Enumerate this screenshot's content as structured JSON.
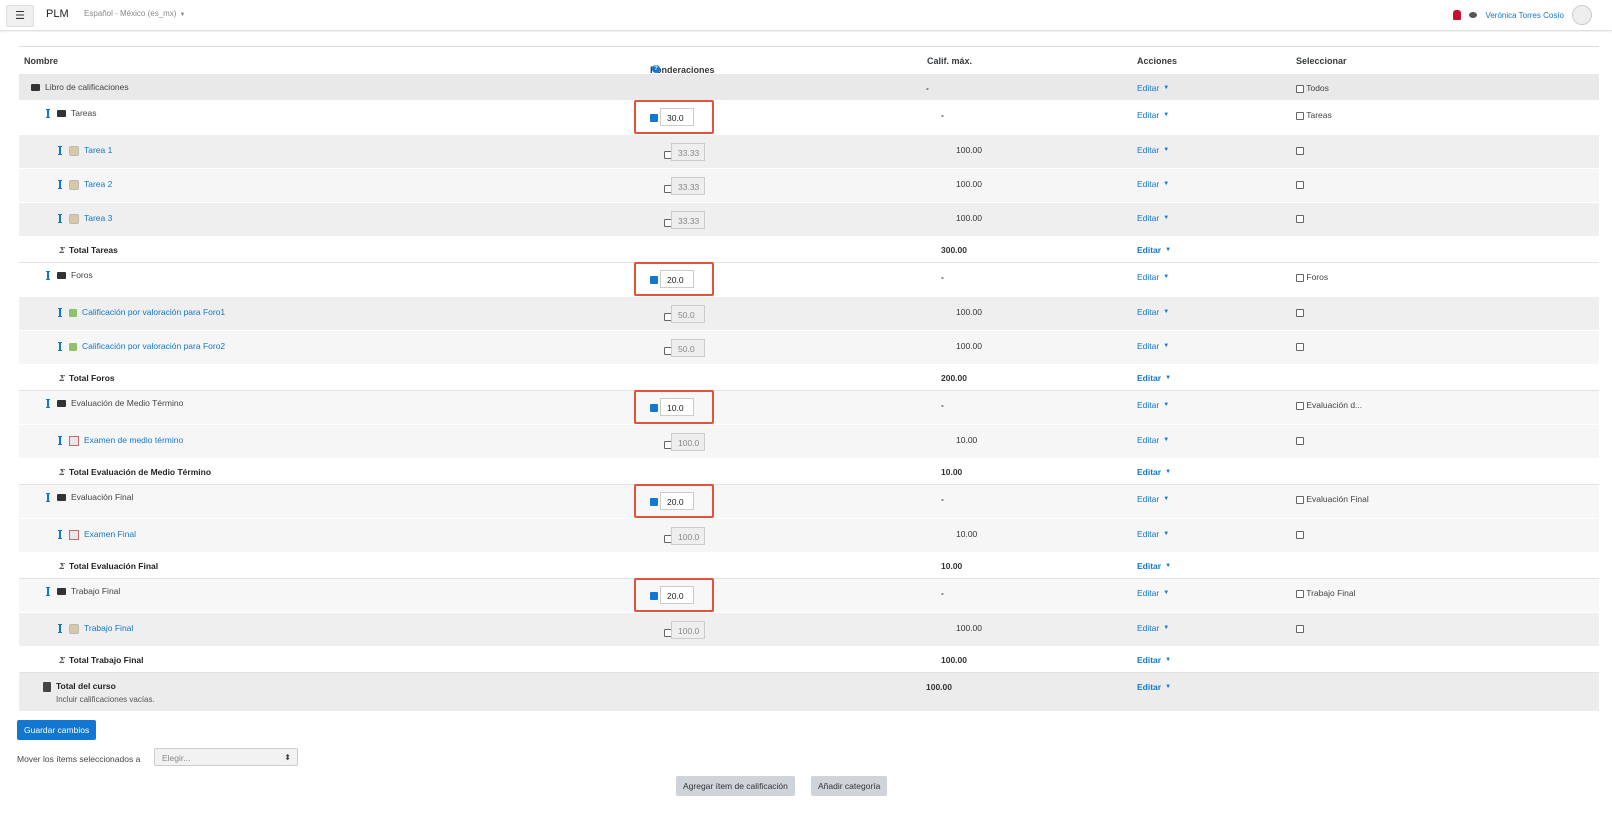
{
  "nav": {
    "menu_icon": "hamburger-icon",
    "brand": "PLM",
    "language": "Español - México (es_mx)",
    "user_name": "Verónica Torres Cosío"
  },
  "table": {
    "headers": {
      "name": "Nombre",
      "weights": "Ponderaciones",
      "max": "Calif. máx.",
      "actions": "Acciones",
      "select": "Seleccionar"
    },
    "rows": [
      {
        "name": "Libro de calificaciones",
        "max": "-",
        "action": "Editar",
        "select": "Todos"
      },
      {
        "name": "Tareas",
        "weight": "30.0",
        "max": "-",
        "action": "Editar",
        "select": "Tareas"
      },
      {
        "name": "Tarea 1",
        "weight": "33.33",
        "max": "100.00",
        "action": "Editar",
        "select": ""
      },
      {
        "name": "Tarea 2",
        "weight": "33.33",
        "max": "100.00",
        "action": "Editar",
        "select": ""
      },
      {
        "name": "Tarea 3",
        "weight": "33.33",
        "max": "100.00",
        "action": "Editar",
        "select": ""
      },
      {
        "name": "Total Tareas",
        "max": "300.00",
        "action": "Editar"
      },
      {
        "name": "Foros",
        "weight": "20.0",
        "max": "-",
        "action": "Editar",
        "select": "Foros"
      },
      {
        "name": "Calificación por valoración para Foro1",
        "weight": "50.0",
        "max": "100.00",
        "action": "Editar",
        "select": ""
      },
      {
        "name": "Calificación por valoración para Foro2",
        "weight": "50.0",
        "max": "100.00",
        "action": "Editar",
        "select": ""
      },
      {
        "name": "Total Foros",
        "max": "200.00",
        "action": "Editar"
      },
      {
        "name": "Evaluación de Medio Término",
        "weight": "10.0",
        "max": "-",
        "action": "Editar",
        "select": "Evaluación d..."
      },
      {
        "name": "Examen de medio término",
        "weight": "100.0",
        "max": "10.00",
        "action": "Editar",
        "select": ""
      },
      {
        "name": "Total Evaluación de Medio Término",
        "max": "10.00",
        "action": "Editar"
      },
      {
        "name": "Evaluación Final",
        "weight": "20.0",
        "max": "-",
        "action": "Editar",
        "select": "Evaluación Final"
      },
      {
        "name": "Examen Final",
        "weight": "100.0",
        "max": "10.00",
        "action": "Editar",
        "select": ""
      },
      {
        "name": "Total Evaluación Final",
        "max": "10.00",
        "action": "Editar"
      },
      {
        "name": "Trabajo Final",
        "weight": "20.0",
        "max": "-",
        "action": "Editar",
        "select": "Trabajo Final"
      },
      {
        "name": "Trabajo Final",
        "weight": "100.0",
        "max": "100.00",
        "action": "Editar",
        "select": ""
      },
      {
        "name": "Total Trabajo Final",
        "max": "100.00",
        "action": "Editar"
      },
      {
        "name": "Total del curso",
        "sub": "Incluir calificaciones vacías.",
        "max": "100.00",
        "action": "Editar"
      }
    ]
  },
  "footer": {
    "save_button": "Guardar cambios",
    "move_label": "Mover los ítems seleccionados a",
    "move_select": "Elegir...",
    "add_item_button": "Agregar ítem de calificación",
    "add_category_button": "Añadir categoría"
  }
}
